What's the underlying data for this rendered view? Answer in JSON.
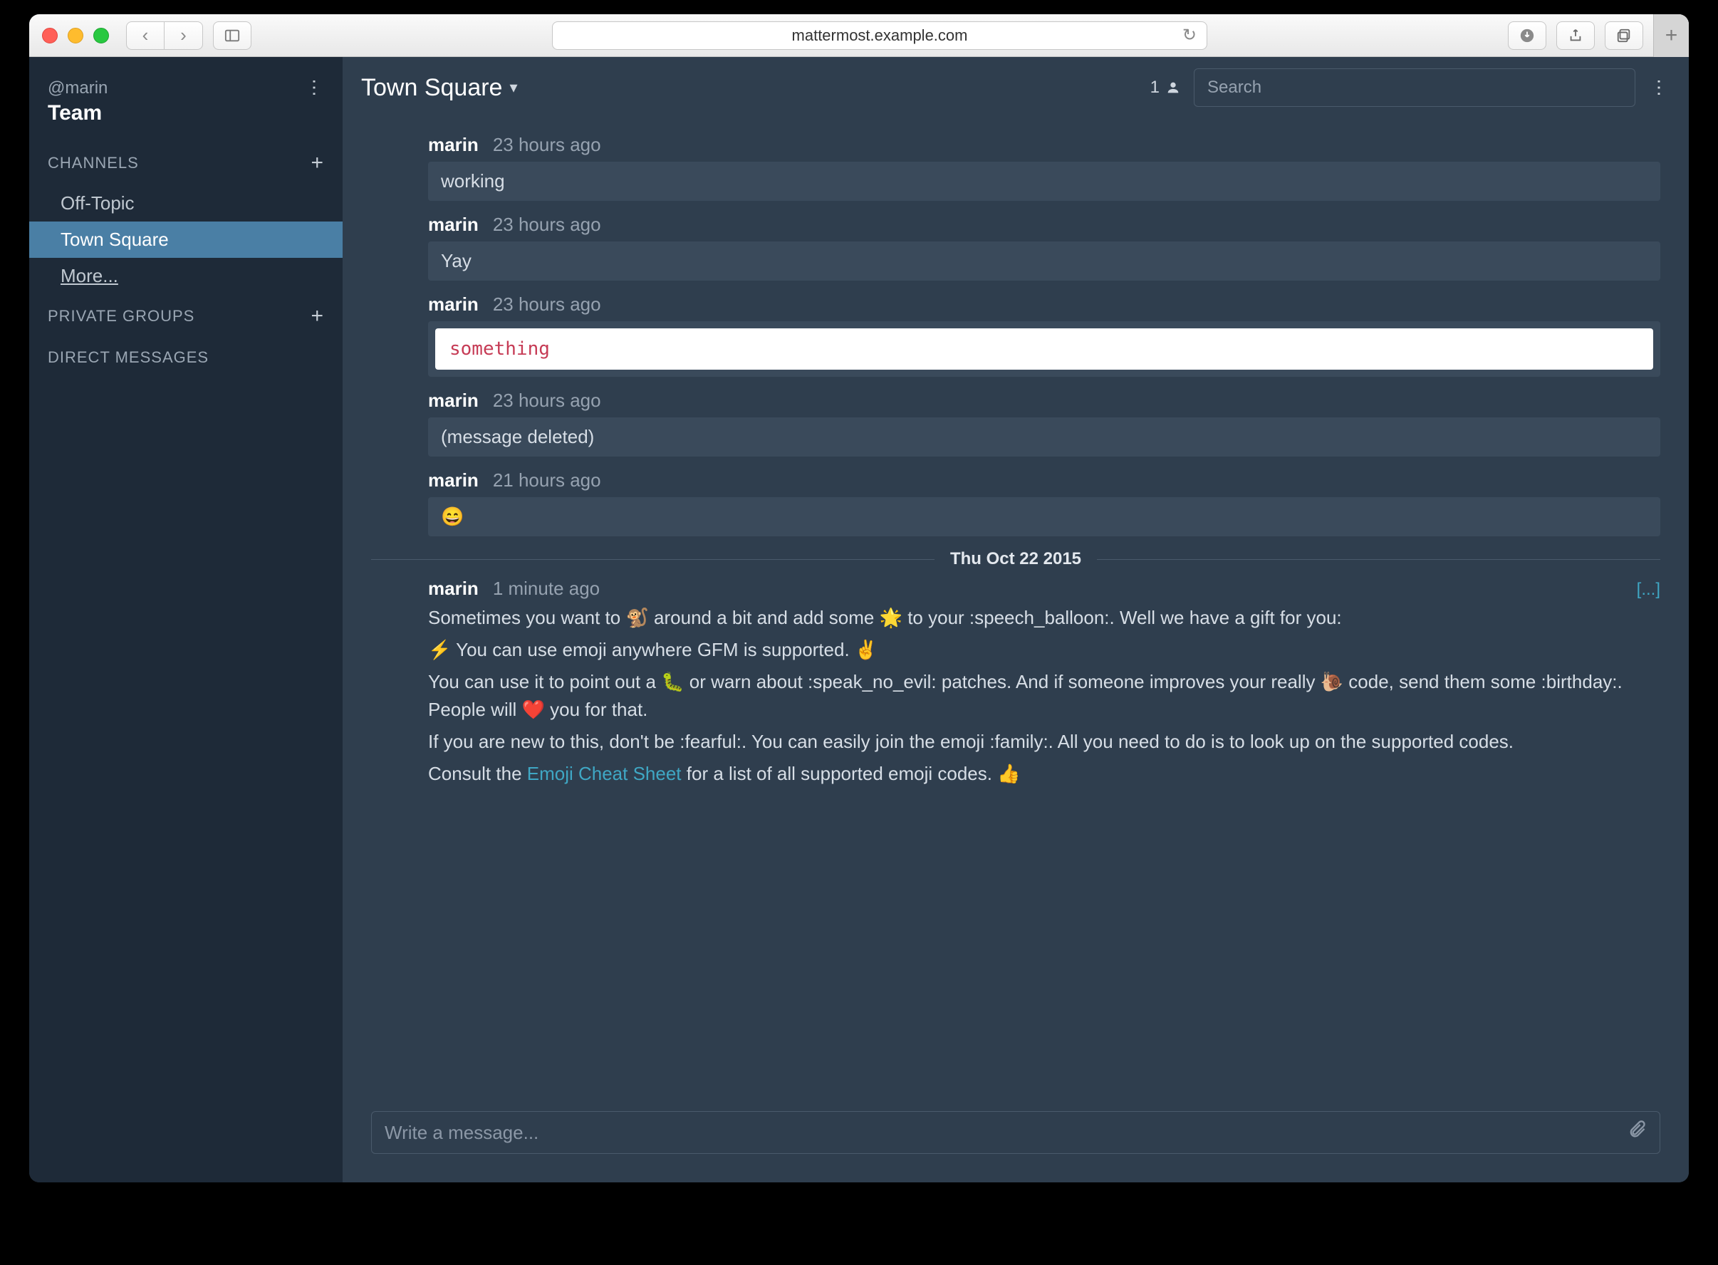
{
  "browser": {
    "url": "mattermost.example.com"
  },
  "sidebar": {
    "user_handle": "@marin",
    "team": "Team",
    "channels_label": "CHANNELS",
    "channels": [
      {
        "label": "Off-Topic",
        "active": false
      },
      {
        "label": "Town Square",
        "active": true
      },
      {
        "label": "More...",
        "active": false
      }
    ],
    "private_label": "PRIVATE GROUPS",
    "direct_label": "DIRECT MESSAGES"
  },
  "channel_header": {
    "name": "Town Square",
    "member_count": "1"
  },
  "search": {
    "placeholder": "Search"
  },
  "date_separator": "Thu Oct 22 2015",
  "posts": [
    {
      "author": "marin",
      "time": "23 hours ago",
      "type": "text",
      "body": "working"
    },
    {
      "author": "marin",
      "time": "23 hours ago",
      "type": "text",
      "body": "Yay"
    },
    {
      "author": "marin",
      "time": "23 hours ago",
      "type": "code",
      "body": "something"
    },
    {
      "author": "marin",
      "time": "23 hours ago",
      "type": "text",
      "body": "(message deleted)"
    },
    {
      "author": "marin",
      "time": "21 hours ago",
      "type": "text",
      "body": "😄"
    }
  ],
  "long_post": {
    "author": "marin",
    "time": "1 minute ago",
    "collapse": "[...]",
    "p1": "Sometimes you want to 🐒 around a bit and add some 🌟 to your :speech_balloon:. Well we have a gift for you:",
    "p2": "⚡ You can use emoji anywhere GFM is supported. ✌️",
    "p3": "You can use it to point out a 🐛 or warn about :speak_no_evil: patches. And if someone improves your really 🐌 code, send them some :birthday:. People will ❤️ you for that.",
    "p4": "If you are new to this, don't be :fearful:. You can easily join the emoji :family:. All you need to do is to look up on the supported codes.",
    "p5a": "Consult the ",
    "p5link": "Emoji Cheat Sheet",
    "p5b": " for a list of all supported emoji codes. 👍"
  },
  "compose": {
    "placeholder": "Write a message..."
  }
}
